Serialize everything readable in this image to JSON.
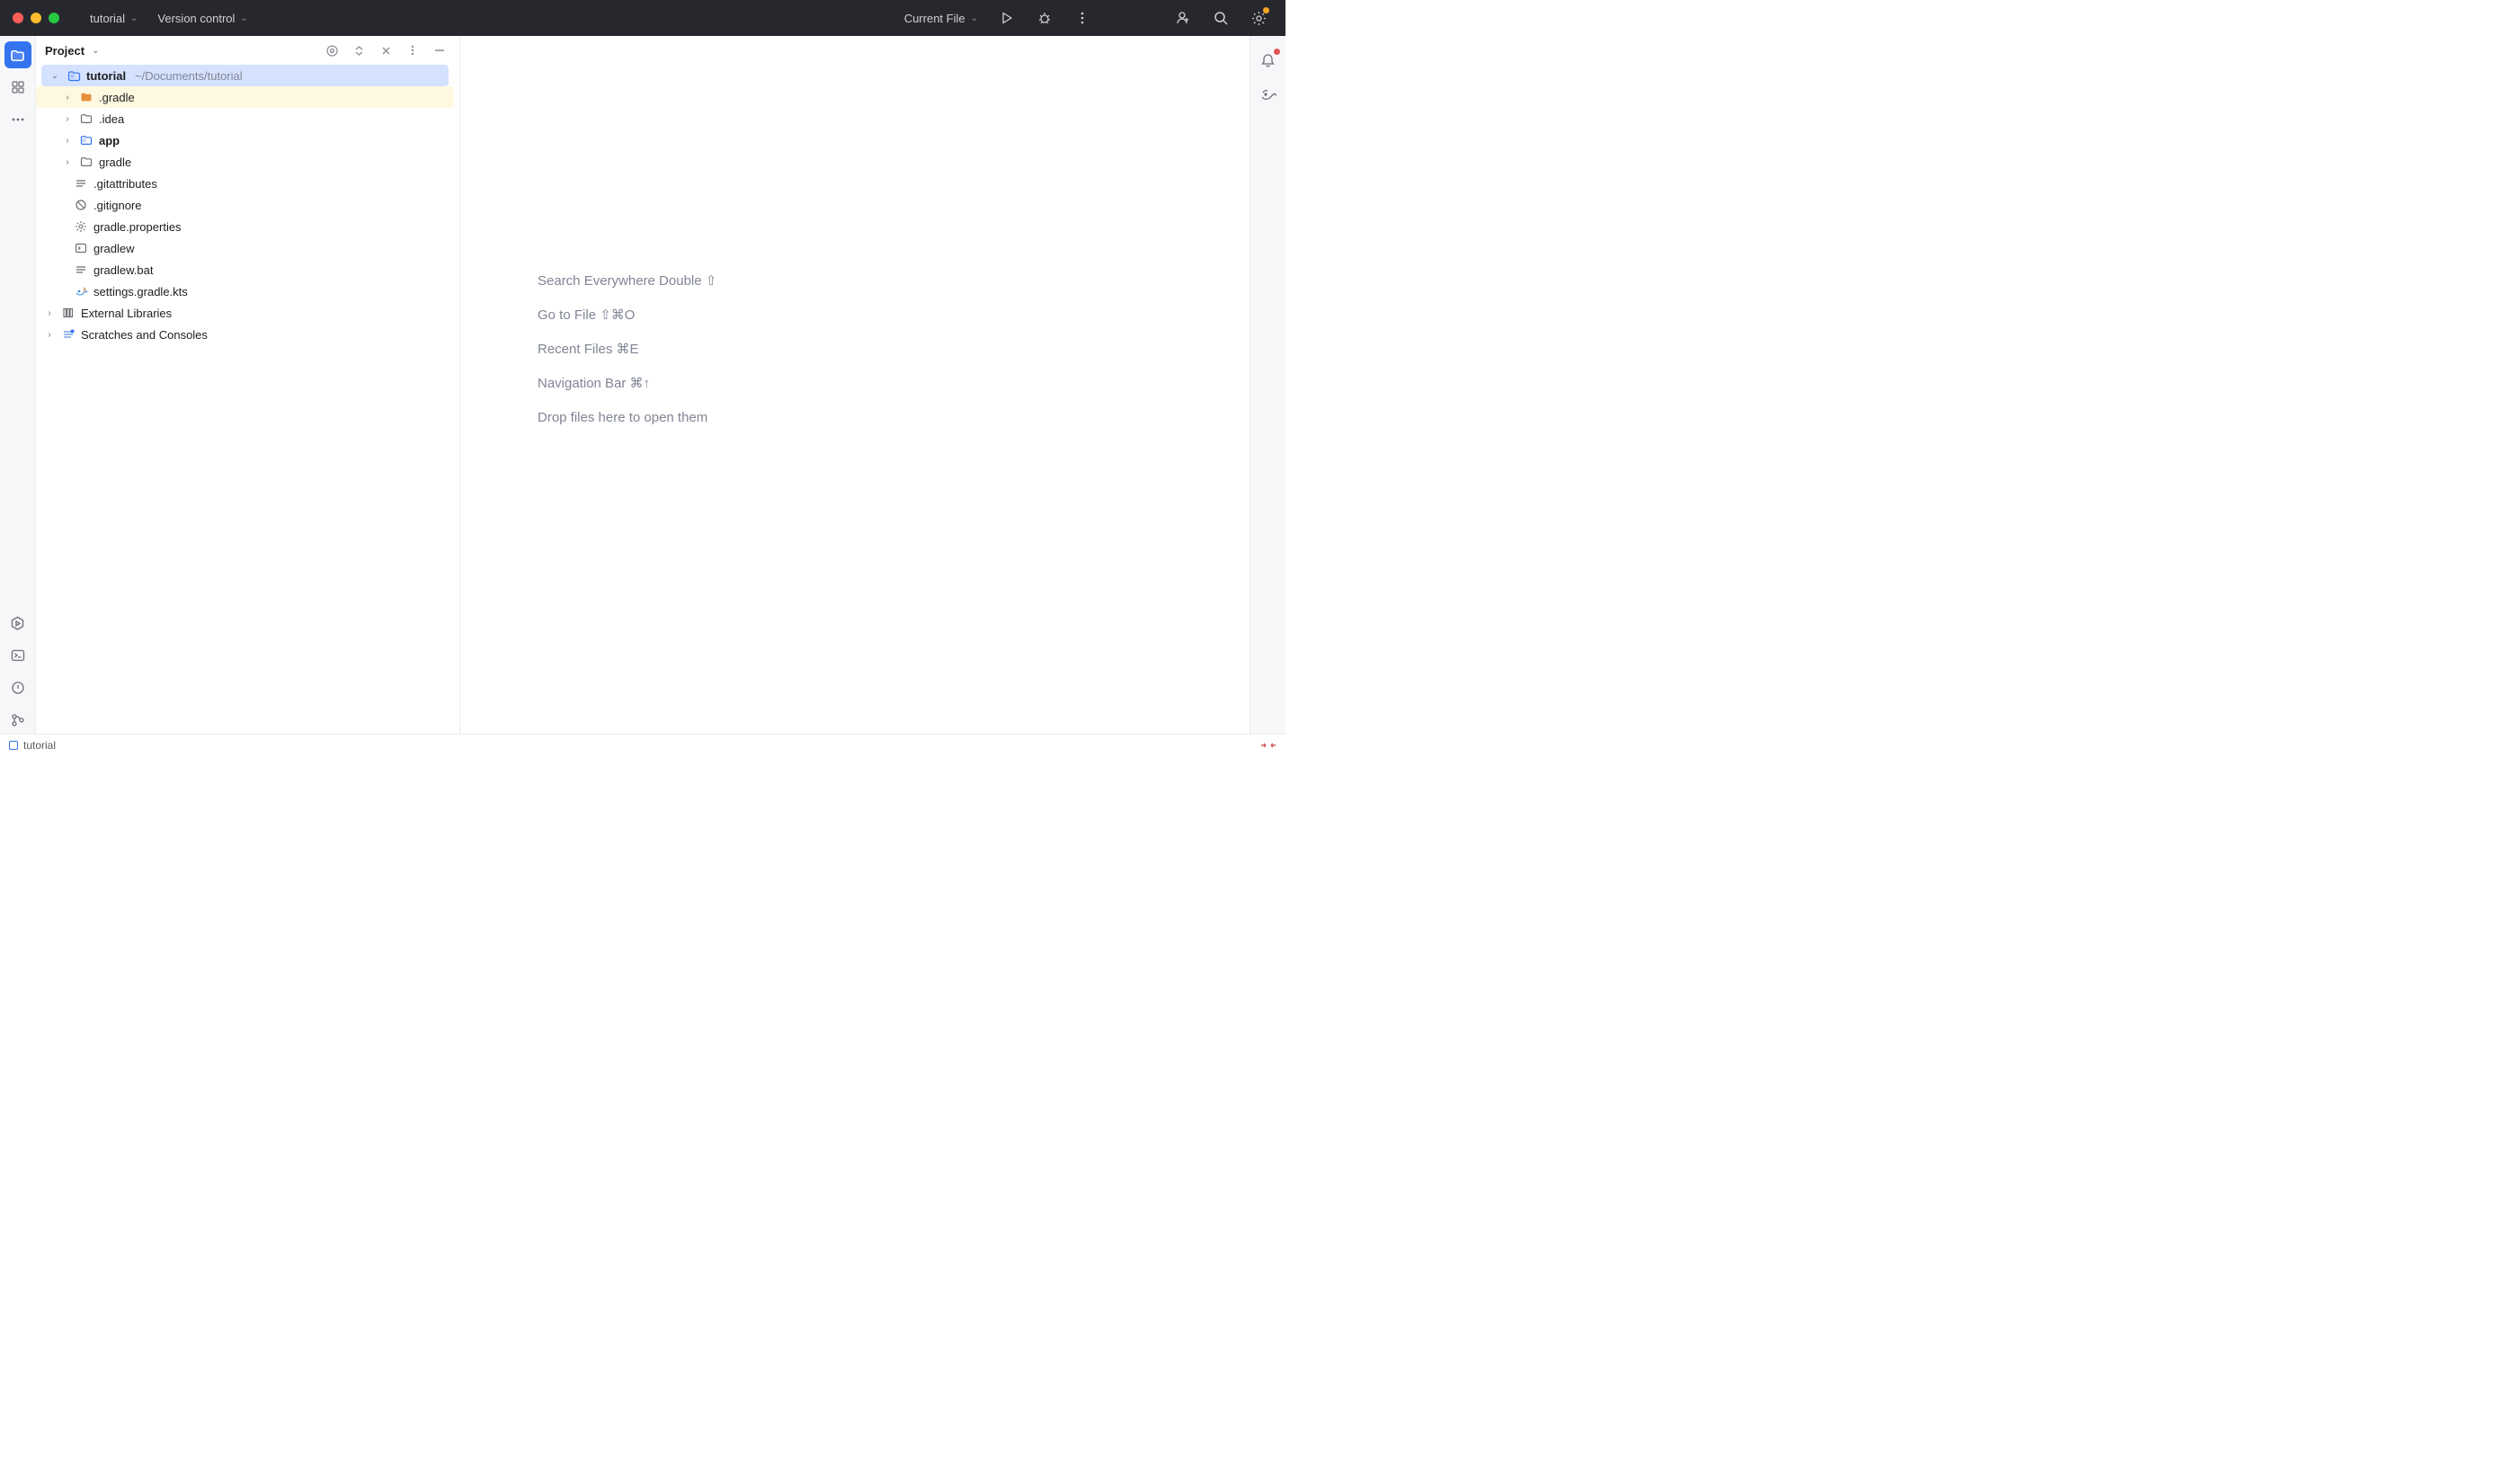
{
  "titlebar": {
    "project_name": "tutorial",
    "vcs_label": "Version control",
    "run_config": "Current File"
  },
  "panel": {
    "title": "Project"
  },
  "tree": {
    "root": {
      "name": "tutorial",
      "path": "~/Documents/tutorial"
    },
    "items": [
      {
        "name": ".gradle"
      },
      {
        "name": ".idea"
      },
      {
        "name": "app"
      },
      {
        "name": "gradle"
      },
      {
        "name": ".gitattributes"
      },
      {
        "name": ".gitignore"
      },
      {
        "name": "gradle.properties"
      },
      {
        "name": "gradlew"
      },
      {
        "name": "gradlew.bat"
      },
      {
        "name": "settings.gradle.kts"
      }
    ],
    "external_libs": "External Libraries",
    "scratches": "Scratches and Consoles"
  },
  "tips": {
    "search": "Search Everywhere Double ⇧",
    "goto": "Go to File ⇧⌘O",
    "recent": "Recent Files ⌘E",
    "navbar": "Navigation Bar ⌘↑",
    "drop": "Drop files here to open them"
  },
  "status": {
    "module": "tutorial"
  }
}
